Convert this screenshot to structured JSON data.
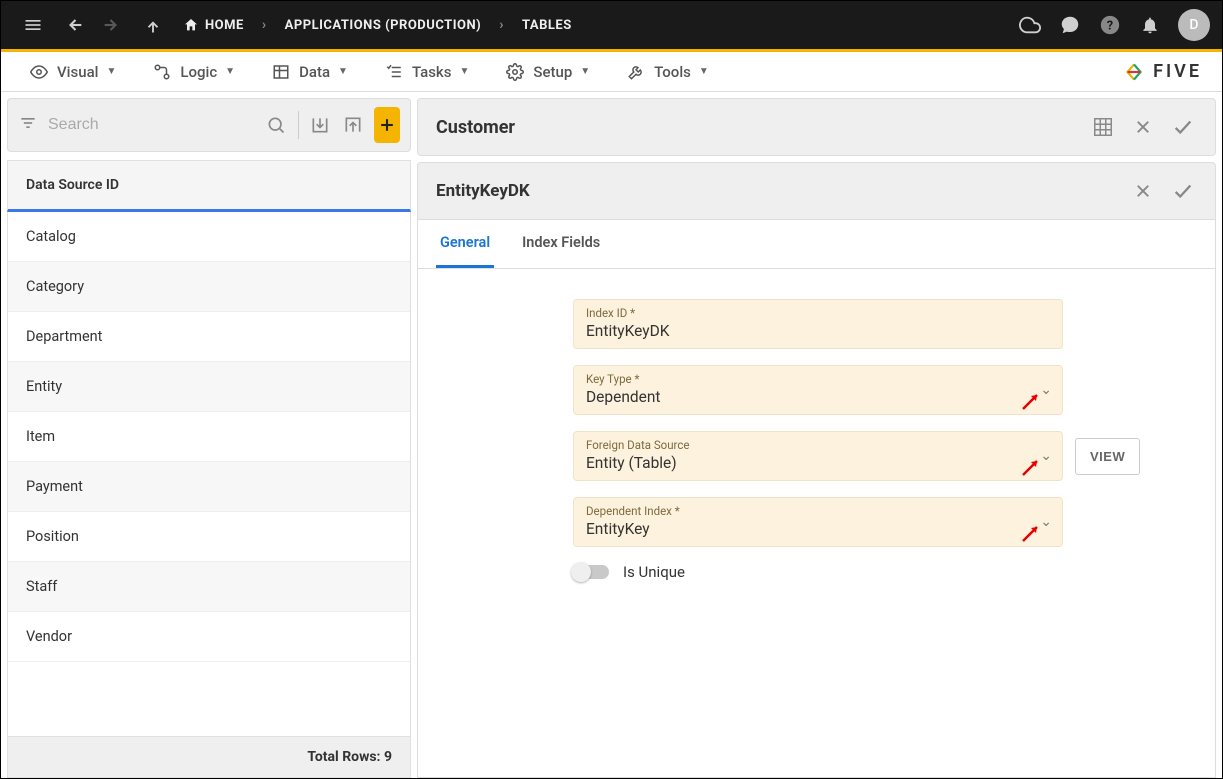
{
  "topbar": {
    "home": "HOME",
    "crumbs": [
      "APPLICATIONS (PRODUCTION)",
      "TABLES"
    ],
    "avatar": "D"
  },
  "menubar": {
    "items": [
      {
        "label": "Visual"
      },
      {
        "label": "Logic"
      },
      {
        "label": "Data"
      },
      {
        "label": "Tasks"
      },
      {
        "label": "Setup"
      },
      {
        "label": "Tools"
      }
    ],
    "brand": "FIVE"
  },
  "sidebar": {
    "search_placeholder": "Search",
    "header": "Data Source ID",
    "items": [
      {
        "label": "Catalog"
      },
      {
        "label": "Category"
      },
      {
        "label": "Department"
      },
      {
        "label": "Entity"
      },
      {
        "label": "Item"
      },
      {
        "label": "Payment"
      },
      {
        "label": "Position"
      },
      {
        "label": "Staff"
      },
      {
        "label": "Vendor"
      }
    ],
    "footer": "Total Rows: 9"
  },
  "detail": {
    "title": "Customer",
    "subtitle": "EntityKeyDK",
    "tabs": [
      {
        "label": "General",
        "active": true
      },
      {
        "label": "Index Fields",
        "active": false
      }
    ],
    "fields": {
      "index_id": {
        "label": "Index ID *",
        "value": "EntityKeyDK"
      },
      "key_type": {
        "label": "Key Type *",
        "value": "Dependent"
      },
      "foreign_ds": {
        "label": "Foreign Data Source",
        "value": "Entity (Table)"
      },
      "dependent_index": {
        "label": "Dependent Index *",
        "value": "EntityKey"
      }
    },
    "view_button": "VIEW",
    "is_unique_label": "Is Unique",
    "is_unique_value": false
  }
}
